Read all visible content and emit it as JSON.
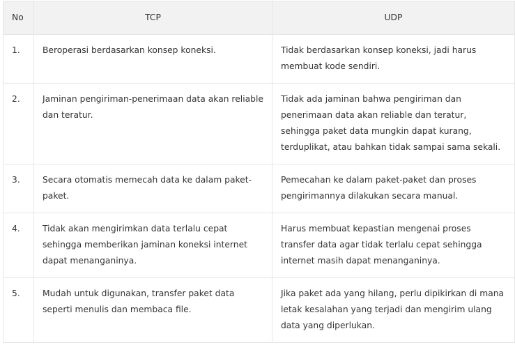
{
  "table": {
    "headers": {
      "no": "No",
      "tcp": "TCP",
      "udp": "UDP"
    },
    "rows": [
      {
        "no": "1.",
        "tcp": "Beroperasi berdasarkan konsep koneksi.",
        "udp": "Tidak berdasarkan konsep koneksi, jadi harus membuat kode sendiri."
      },
      {
        "no": "2.",
        "tcp": "Jaminan pengiriman-penerimaan data akan reliable dan teratur.",
        "udp": "Tidak ada jaminan bahwa pengiriman dan penerimaan data akan reliable dan teratur, sehingga paket data mungkin dapat kurang, terduplikat, atau bahkan tidak sampai sama sekali."
      },
      {
        "no": "3.",
        "tcp": "Secara otomatis memecah data ke dalam paket-paket.",
        "udp": "Pemecahan ke dalam paket-paket dan proses pengirimannya dilakukan secara manual."
      },
      {
        "no": "4.",
        "tcp": "Tidak akan mengirimkan data terlalu cepat sehingga memberikan jaminan koneksi internet dapat menanganinya.",
        "udp": "Harus membuat kepastian mengenai proses transfer data agar tidak terlalu cepat sehingga internet masih dapat menanganinya."
      },
      {
        "no": "5.",
        "tcp": "Mudah untuk digunakan, transfer paket data seperti menulis dan membaca file.",
        "udp": "Jika paket ada yang hilang, perlu dipikirkan di mana letak kesalahan yang terjadi dan mengirim ulang data yang diperlukan."
      }
    ]
  }
}
